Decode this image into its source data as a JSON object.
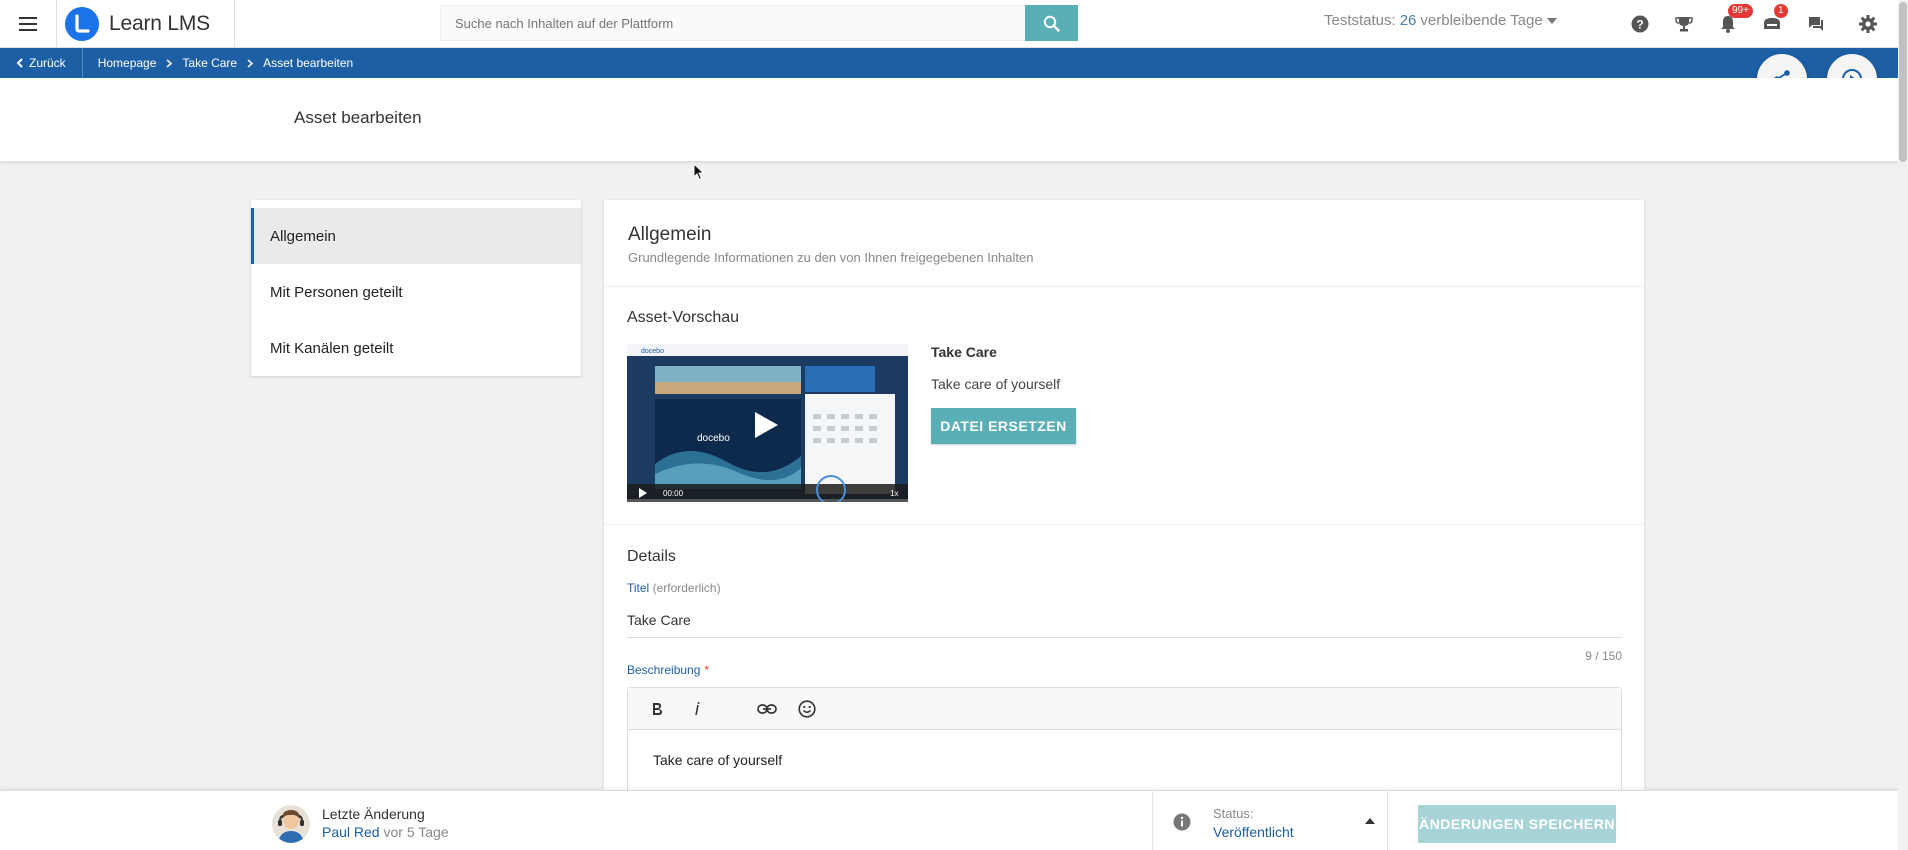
{
  "app": {
    "name": "Learn LMS"
  },
  "search": {
    "placeholder": "Suche nach Inhalten auf der Plattform"
  },
  "trial": {
    "prefix": "Teststatus:",
    "days": "26",
    "suffix": "verbleibende Tage"
  },
  "notifications": {
    "bell_badge": "99+",
    "inbox_badge": "1"
  },
  "breadcrumb": {
    "back": "Zurück",
    "items": [
      "Homepage",
      "Take Care",
      "Asset bearbeiten"
    ]
  },
  "page": {
    "title": "Asset bearbeiten"
  },
  "sidenav": {
    "items": [
      "Allgemein",
      "Mit Personen geteilt",
      "Mit Kanälen geteilt"
    ]
  },
  "general": {
    "title": "Allgemein",
    "subtitle": "Grundlegende Informationen zu den von Ihnen freigegebenen Inhalten"
  },
  "preview": {
    "section_title": "Asset-Vorschau",
    "asset_title": "Take Care",
    "asset_description": "Take care of yourself",
    "replace_button": "DATEI ERSETZEN",
    "video_time": "00:00",
    "video_speed": "1x",
    "video_brand": "docebo"
  },
  "details": {
    "section_title": "Details",
    "title_label": "Titel",
    "title_hint": "(erforderlich)",
    "title_value": "Take Care",
    "title_counter": "9 / 150",
    "description_label": "Beschreibung",
    "description_required": "*",
    "description_value": "Take care of yourself"
  },
  "footer": {
    "last_change_label": "Letzte Änderung",
    "user": "Paul Red",
    "time": "vor 5 Tage",
    "status_label": "Status:",
    "status_value": "Veröffentlicht",
    "save_button": "ÄNDERUNGEN SPEICHERN"
  },
  "colors": {
    "brand_blue": "#1d5fa5",
    "accent_teal": "#5aafb6",
    "logo_blue": "#1a73e8"
  }
}
